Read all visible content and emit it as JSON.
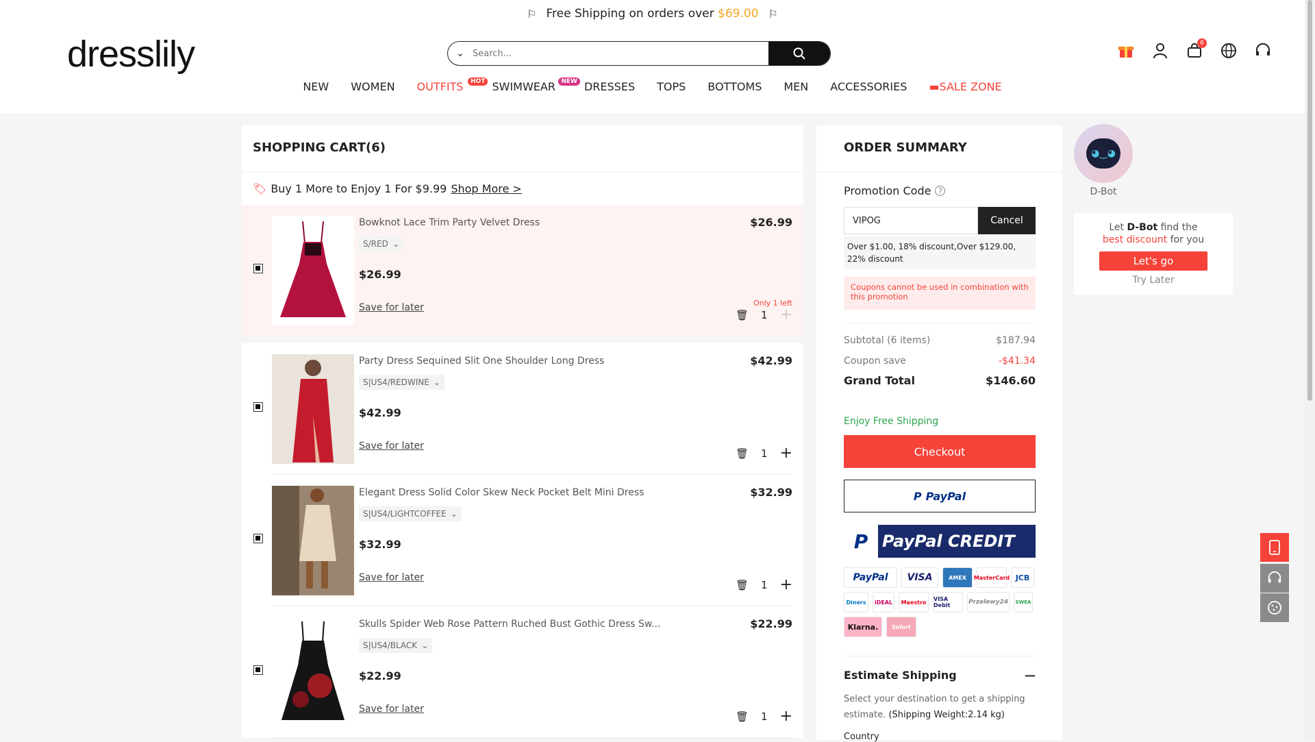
{
  "promo_bar": {
    "text": "Free Shipping on orders over",
    "amount": "$69.00"
  },
  "logo": "dresslily",
  "search": {
    "placeholder": "Search..."
  },
  "header_icons": {
    "cart_count": "6"
  },
  "nav": [
    {
      "label": "NEW"
    },
    {
      "label": "WOMEN"
    },
    {
      "label": "OUTFITS",
      "tag": "HOT"
    },
    {
      "label": "SWIMWEAR",
      "tag": "NEW"
    },
    {
      "label": "DRESSES"
    },
    {
      "label": "TOPS"
    },
    {
      "label": "BOTTOMS"
    },
    {
      "label": "MEN"
    },
    {
      "label": "ACCESSORIES"
    },
    {
      "label": "SALE ZONE"
    }
  ],
  "cart": {
    "title": "SHOPPING CART(6)",
    "promo_text": "Buy 1 More to Enjoy 1 For $9.99",
    "promo_link": "Shop More >",
    "items": [
      {
        "name": "Bowknot Lace Trim Party Velvet Dress",
        "variant": "S/RED",
        "price": "$26.99",
        "save": "Save for later",
        "qty": "1",
        "stock": "Only 1 left"
      },
      {
        "name": "Party Dress Sequined Slit One Shoulder Long Dress",
        "variant": "S|US4/REDWINE",
        "price": "$42.99",
        "save": "Save for later",
        "qty": "1"
      },
      {
        "name": "Elegant Dress Solid Color Skew Neck Pocket Belt Mini Dress",
        "variant": "S|US4/LIGHTCOFFEE",
        "price": "$32.99",
        "save": "Save for later",
        "qty": "1"
      },
      {
        "name": "Skulls Spider Web Rose Pattern Ruched Bust Gothic Dress Sw...",
        "variant": "S|US4/BLACK",
        "price": "$22.99",
        "save": "Save for later",
        "qty": "1"
      }
    ]
  },
  "summary": {
    "title": "ORDER SUMMARY",
    "promo_label": "Promotion Code",
    "promo_value": "VIPOG",
    "cancel": "Cancel",
    "promo_info": "Over $1.00, 18% discount,Over $129.00, 22% discount",
    "promo_warn": "Coupons cannot be used in combination with this promotion",
    "subtotal_label": "Subtotal (6 items)",
    "subtotal": "$187.94",
    "coupon_label": "Coupon save",
    "coupon": "-$41.34",
    "grand_label": "Grand Total",
    "grand": "$146.60",
    "free_shipping": "Enjoy Free Shipping",
    "checkout": "Checkout",
    "paypal": "PayPal",
    "paypal_credit": "PayPal CREDIT",
    "cards": [
      "PayPal",
      "VISA",
      "AMEX",
      "MasterCard",
      "JCB",
      "Diners",
      "iDEAL",
      "Maestro",
      "VISA Debit",
      "Przelewy24",
      "SWEA",
      "Klarna.",
      "Sofort"
    ],
    "est_title": "Estimate Shipping",
    "est_text": "Select your destination to get a shipping estimate.",
    "est_weight": "(Shipping Weight:2.14 kg)",
    "country": "Country"
  },
  "dbot": {
    "name": "D-Bot",
    "line1_pre": "Let ",
    "line1_bold": "D-Bot",
    "line1_post": " find the",
    "line2_red": "best discount",
    "line2_post": " for you",
    "go": "Let's go",
    "later": "Try Later"
  },
  "colors": {
    "accent": "#f5433a",
    "promo_amount": "#f5a623",
    "free_ship": "#2da44e"
  }
}
